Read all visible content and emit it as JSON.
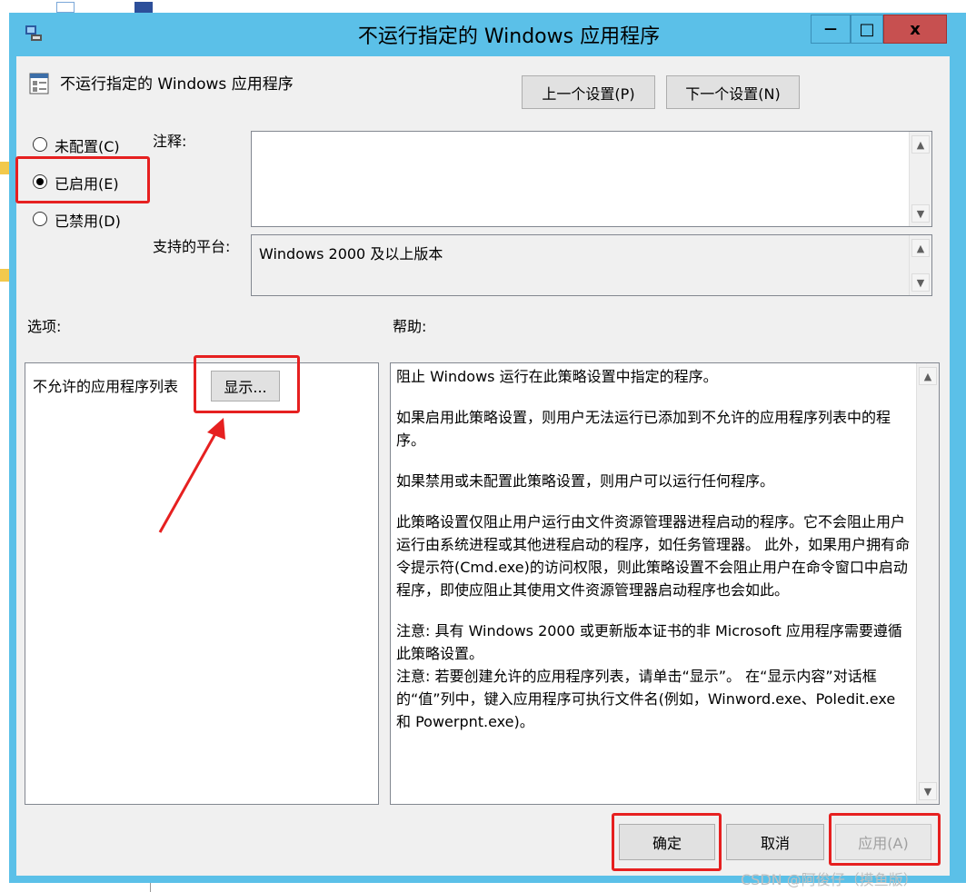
{
  "dialog": {
    "title": "不运行指定的 Windows 应用程序",
    "minimize": "—",
    "maximize": "□",
    "close": "x"
  },
  "header": {
    "policy_name": "不运行指定的 Windows 应用程序",
    "prev_button": "上一个设置(P)",
    "next_button": "下一个设置(N)"
  },
  "state": {
    "not_configured": "未配置(C)",
    "enabled": "已启用(E)",
    "disabled": "已禁用(D)",
    "selected": "enabled"
  },
  "comment": {
    "label": "注释:",
    "value": ""
  },
  "platform": {
    "label": "支持的平台:",
    "value": "Windows 2000 及以上版本"
  },
  "options": {
    "label": "选项:",
    "list_label": "不允许的应用程序列表",
    "show_button": "显示..."
  },
  "help": {
    "label": "帮助:",
    "paragraphs": [
      "阻止 Windows 运行在此策略设置中指定的程序。",
      "如果启用此策略设置，则用户无法运行已添加到不允许的应用程序列表中的程序。",
      "如果禁用或未配置此策略设置，则用户可以运行任何程序。",
      "此策略设置仅阻止用户运行由文件资源管理器进程启动的程序。它不会阻止用户运行由系统进程或其他进程启动的程序，如任务管理器。 此外，如果用户拥有命令提示符(Cmd.exe)的访问权限，则此策略设置不会阻止用户在命令窗口中启动程序，即使应阻止其使用文件资源管理器启动程序也会如此。",
      "注意: 具有 Windows 2000 或更新版本证书的非 Microsoft 应用程序需要遵循此策略设置。",
      "注意: 若要创建允许的应用程序列表，请单击“显示”。 在“显示内容”对话框的“值”列中，键入应用程序可执行文件名(例如，Winword.exe、Poledit.exe 和 Powerpnt.exe)。"
    ]
  },
  "footer": {
    "ok": "确定",
    "cancel": "取消",
    "apply": "应用(A)"
  },
  "watermark": "CSDN @阿俊仔（摸鱼版）",
  "colors": {
    "title_bar": "#5bc0e8",
    "close_button": "#c75050",
    "annotation": "#e62020",
    "client": "#f0f0f0"
  },
  "icons": [
    "app-icon",
    "policy-icon",
    "scroll-up-icon",
    "scroll-down-icon",
    "arrow-annotation"
  ]
}
